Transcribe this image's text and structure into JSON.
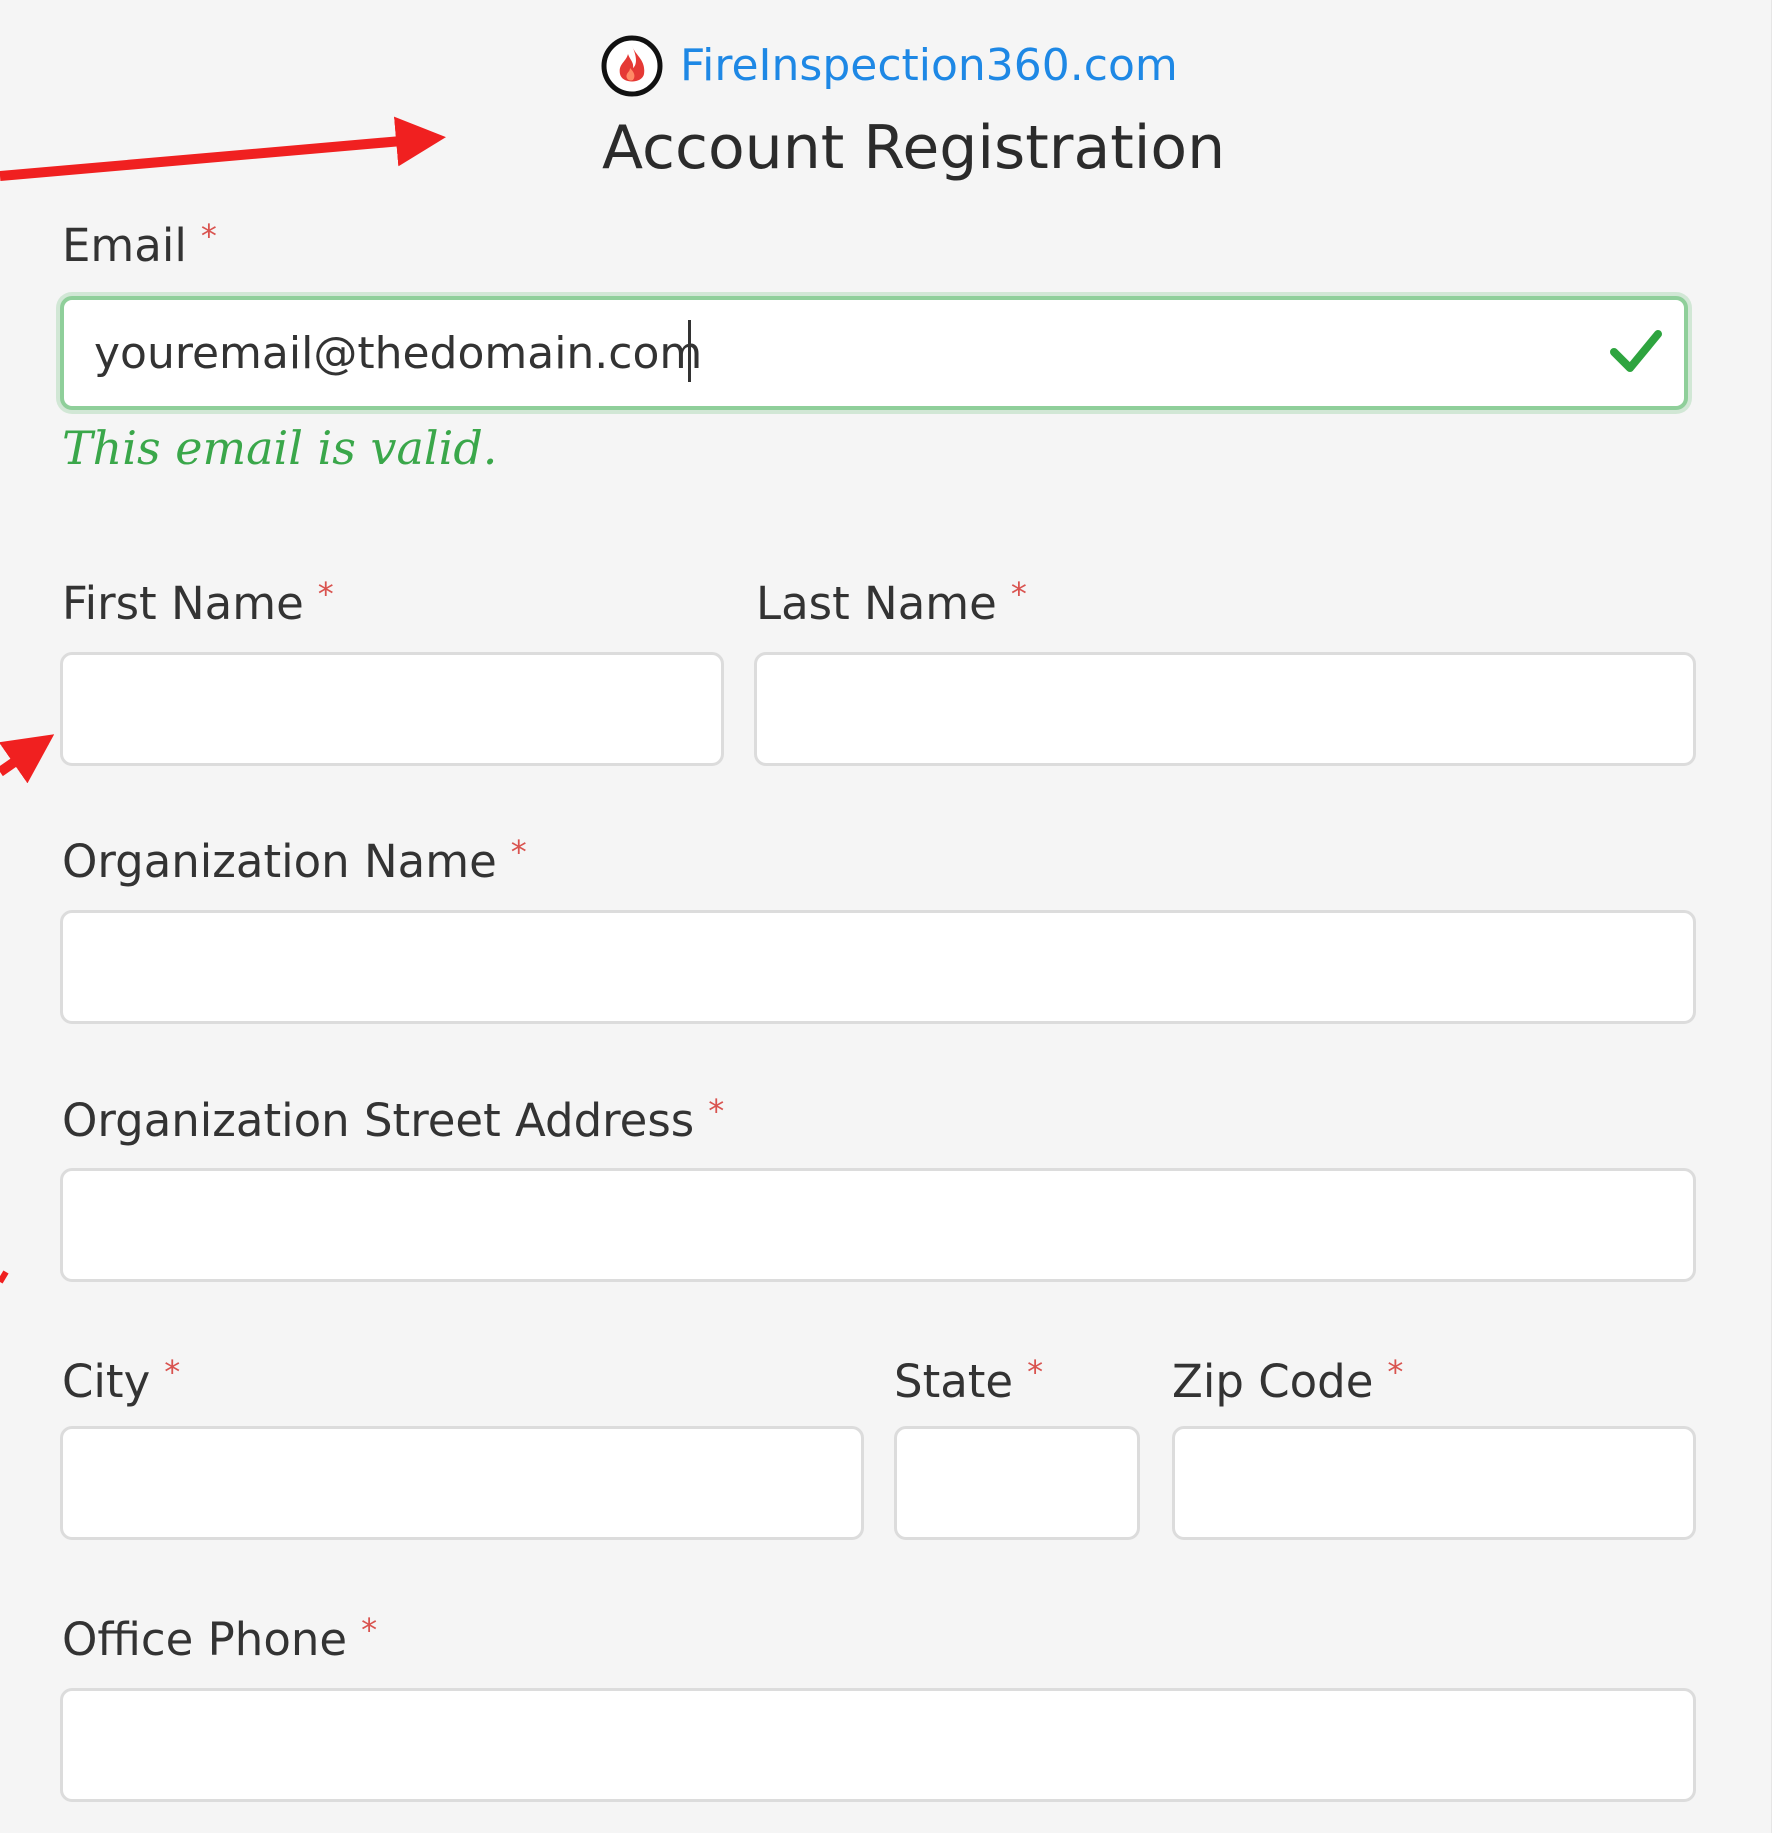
{
  "brand": {
    "name": "FireInspection360.com",
    "logo_icon": "flame-icon",
    "logo_color": "#e53935",
    "name_color": "#1e88e5"
  },
  "page": {
    "title": "Account Registration"
  },
  "required_marker": "*",
  "form": {
    "email": {
      "label": "Email",
      "value": "youremail@thedomain.com",
      "valid_message": "This email is valid.",
      "status_icon": "checkmark-icon",
      "status_color": "#2ea43f"
    },
    "first_name": {
      "label": "First Name",
      "value": ""
    },
    "last_name": {
      "label": "Last Name",
      "value": ""
    },
    "organization_name": {
      "label": "Organization Name",
      "value": ""
    },
    "street_address": {
      "label": "Organization Street Address",
      "value": ""
    },
    "city": {
      "label": "City",
      "value": ""
    },
    "state": {
      "label": "State",
      "value": ""
    },
    "zip_code": {
      "label": "Zip Code",
      "value": ""
    },
    "office_phone": {
      "label": "Office Phone",
      "value": ""
    }
  },
  "annotation_color": "#f02020"
}
